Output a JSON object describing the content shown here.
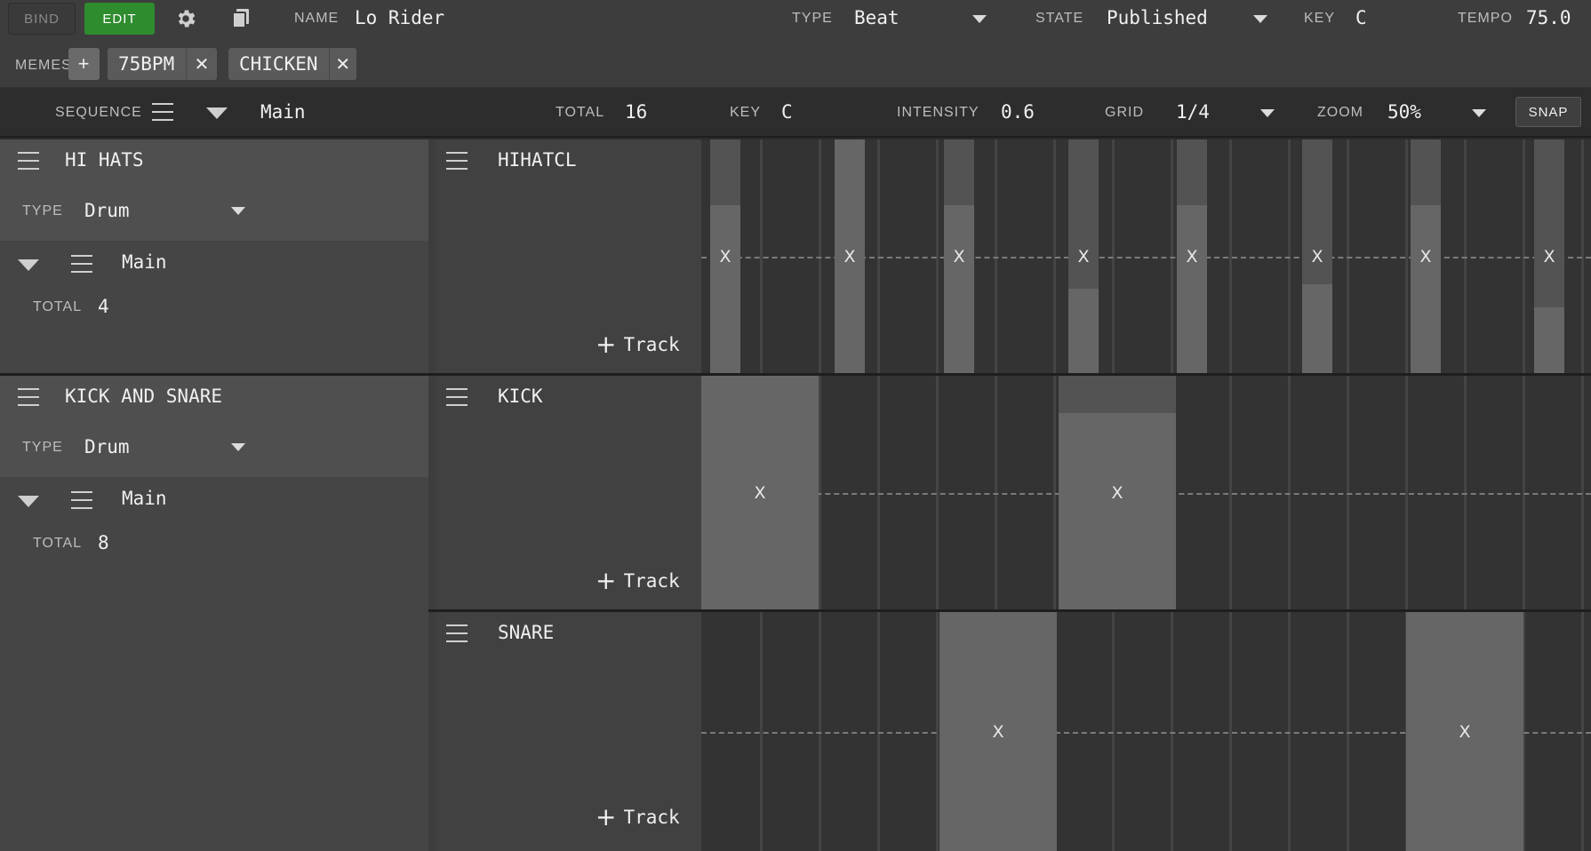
{
  "toolbar": {
    "bind_label": "BIND",
    "edit_label": "EDIT",
    "name_label": "NAME",
    "name_value": "Lo Rider",
    "type_label": "TYPE",
    "type_value": "Beat",
    "state_label": "STATE",
    "state_value": "Published",
    "key_label": "KEY",
    "key_value": "C",
    "tempo_label": "TEMPO",
    "tempo_value": "75.0",
    "colors": {
      "edit_active": "#2e8b2e",
      "bind_inactive": "#3a3a3a"
    }
  },
  "memes": {
    "label": "MEMES",
    "add_label": "+",
    "items": [
      {
        "name": "75BPM"
      },
      {
        "name": "CHICKEN"
      }
    ],
    "remove_icon": "✕"
  },
  "sequence_bar": {
    "label": "SEQUENCE",
    "value": "Main",
    "total_label": "TOTAL",
    "total_value": "16",
    "key_label": "KEY",
    "key_value": "C",
    "intensity_label": "INTENSITY",
    "intensity_value": "0.6",
    "grid_label": "GRID",
    "grid_value": "1/4",
    "zoom_label": "ZOOM",
    "zoom_value": "50%",
    "snap_label": "SNAP"
  },
  "voices": [
    {
      "name": "HI HATS",
      "type_label": "TYPE",
      "type_value": "Drum",
      "sequence_name": "Main",
      "total_label": "TOTAL",
      "total_value": "4",
      "tracks": [
        {
          "name": "HIHATCL",
          "add_track_label": "Track",
          "events": [
            {
              "pos": 0,
              "velocity": 0.72
            },
            {
              "pos": 1,
              "velocity": 1.0
            },
            {
              "pos": 2,
              "velocity": 0.72
            },
            {
              "pos": 3,
              "velocity": 0.36
            },
            {
              "pos": 4,
              "velocity": 0.72
            },
            {
              "pos": 5,
              "velocity": 0.38
            },
            {
              "pos": 6,
              "velocity": 0.72
            },
            {
              "pos": 7,
              "velocity": 0.28
            }
          ]
        }
      ]
    },
    {
      "name": "KICK AND SNARE",
      "type_label": "TYPE",
      "type_value": "Drum",
      "sequence_name": "Main",
      "total_label": "TOTAL",
      "total_value": "8",
      "tracks": [
        {
          "name": "KICK",
          "add_track_label": "Track",
          "events": [
            {
              "pos": 0,
              "velocity": 1.0
            },
            {
              "pos": 2,
              "velocity": 0.84
            }
          ]
        },
        {
          "name": "SNARE",
          "add_track_label": "Track",
          "events": [
            {
              "pos": 1,
              "velocity": 1.0
            },
            {
              "pos": 3,
              "velocity": 1.0
            }
          ]
        }
      ]
    }
  ],
  "event_marker": "X"
}
